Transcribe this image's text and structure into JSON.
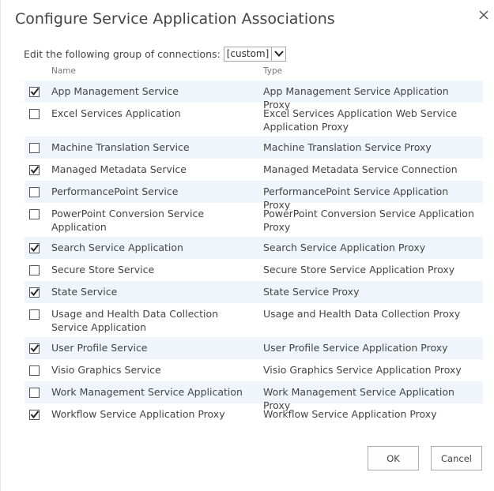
{
  "dialog": {
    "title": "Configure Service Application Associations",
    "close_icon": "close-icon"
  },
  "group": {
    "label": "Edit the following group of connections:",
    "selected": "[custom]"
  },
  "columns": {
    "name": "Name",
    "type": "Type"
  },
  "rows": [
    {
      "checked": true,
      "name": "App Management Service",
      "type": "App Management Service Application Proxy"
    },
    {
      "checked": false,
      "name": "Excel Services Application",
      "type": "Excel Services Application Web Service Application Proxy"
    },
    {
      "checked": false,
      "name": "Machine Translation Service",
      "type": "Machine Translation Service Proxy"
    },
    {
      "checked": true,
      "name": "Managed Metadata Service",
      "type": "Managed Metadata Service Connection"
    },
    {
      "checked": false,
      "name": "PerformancePoint Service",
      "type": "PerformancePoint Service Application Proxy"
    },
    {
      "checked": false,
      "name": "PowerPoint Conversion Service Application",
      "type": "PowerPoint Conversion Service Application Proxy"
    },
    {
      "checked": true,
      "name": "Search Service Application",
      "type": "Search Service Application Proxy"
    },
    {
      "checked": false,
      "name": "Secure Store Service",
      "type": "Secure Store Service Application Proxy"
    },
    {
      "checked": true,
      "name": "State Service",
      "type": "State Service Proxy"
    },
    {
      "checked": false,
      "name": "Usage and Health Data Collection Service Application",
      "type": "Usage and Health Data Collection Proxy"
    },
    {
      "checked": true,
      "name": "User Profile Service",
      "type": "User Profile Service Application Proxy"
    },
    {
      "checked": false,
      "name": "Visio Graphics Service",
      "type": "Visio Graphics Service Application Proxy"
    },
    {
      "checked": false,
      "name": "Work Management Service Application",
      "type": "Work Management Service Application Proxy"
    },
    {
      "checked": true,
      "name": "Workflow Service Application Proxy",
      "type": "Workflow Service Application Proxy"
    }
  ],
  "buttons": {
    "ok": "OK",
    "cancel": "Cancel"
  }
}
